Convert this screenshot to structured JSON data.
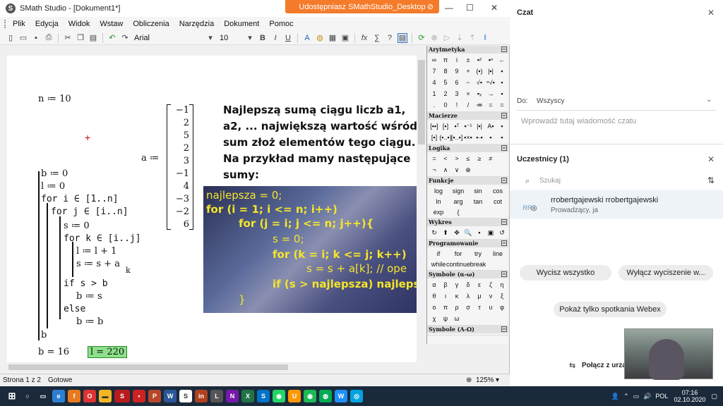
{
  "window": {
    "title": "SMath Studio - [Dokument1*]",
    "share_banner": "Udostępniasz SMathStudio_Desktop"
  },
  "menu": [
    "Plik",
    "Edycja",
    "Widok",
    "Wstaw",
    "Obliczenia",
    "Narzędzia",
    "Dokument",
    "Pomoc"
  ],
  "toolbar": {
    "font": "Arial",
    "size": "10"
  },
  "worksheet": {
    "n_def": "n ≔ 10",
    "a_label": "a ≔",
    "vector": [
      "−1",
      "2",
      "5",
      "2",
      "3",
      "−1",
      "4",
      "−3",
      "−2",
      "6"
    ],
    "code": [
      "b ≔ 0",
      "l ≔ 0",
      "for  i ∈ [1..n]",
      "for  j ∈ [i..n]",
      "s ≔ 0",
      "for  k ∈ [i..j]",
      "l ≔ l + 1",
      "s ≔ s + a",
      "k",
      "if  s > b",
      "b ≔ s",
      "else",
      "b ≔ b",
      "b"
    ],
    "result_b": "b = 16",
    "result_l": "l = 220",
    "text": "Najlepszą sumą ciągu liczb a1, a2, ... największą wartość wśród sum złoż elementów tego ciągu. Na przykład mamy następujące sumy:",
    "image_code": [
      "najlepsza = 0;",
      "for (i = 1; i <= n; i++)",
      "for (j = i; j <= n; j++){",
      "s = 0;",
      "for (k = i; k <= j; k++)",
      "s = s + a[k]; // ope",
      "if (s > najlepsza) najlepsz",
      "}"
    ]
  },
  "palette": {
    "sections": [
      {
        "title": "Arytmetyka",
        "items": [
          "∞",
          "π",
          "i",
          "±",
          "▪²",
          "▪ⁿ",
          "←",
          "7",
          "8",
          "9",
          "+",
          "(▪)",
          "|▪|",
          "▪",
          "4",
          "5",
          "6",
          "−",
          "√▪",
          "ⁿ√▪",
          "▪",
          "1",
          "2",
          "3",
          "×",
          "▪ₓ",
          "→",
          "▪",
          ".",
          "0",
          "!",
          "/",
          "≔",
          "=",
          "="
        ]
      },
      {
        "title": "Macierze",
        "items": [
          "[▪▪]",
          "[▪]",
          "▪ᵀ",
          "▪⁻¹",
          "|▪|",
          "A▪",
          "▪",
          "[▪]",
          "(▪..▪)",
          "[▪..▪]",
          "▪×▪",
          "▪·▪",
          "▪",
          "▪"
        ]
      },
      {
        "title": "Logika",
        "items": [
          "=",
          "<",
          ">",
          "≤",
          "≥",
          "≠",
          "",
          "¬",
          "∧",
          "∨",
          "⊕",
          "",
          "",
          ""
        ]
      },
      {
        "title": "Funkcje",
        "items4": [
          "log",
          "sign",
          "sin",
          "cos",
          "ln",
          "arg",
          "tan",
          "cot",
          "exp",
          "{"
        ]
      },
      {
        "title": "Wykres",
        "items": [
          "↻",
          "⬆",
          "✥",
          "🔍",
          "▪",
          "▣",
          "↺"
        ]
      },
      {
        "title": "Programowanie",
        "items4": [
          "if",
          "for",
          "try",
          "line",
          "while",
          "continue",
          "break",
          ""
        ]
      },
      {
        "title": "Symbole (α-ω)",
        "items": [
          "α",
          "β",
          "γ",
          "δ",
          "ε",
          "ζ",
          "η",
          "θ",
          "ι",
          "κ",
          "λ",
          "μ",
          "ν",
          "ξ",
          "ο",
          "π",
          "ρ",
          "σ",
          "τ",
          "υ",
          "φ",
          "χ",
          "ψ",
          "ω"
        ]
      },
      {
        "title": "Symbole (A-Ω)",
        "items": []
      }
    ]
  },
  "statusbar": {
    "page": "Strona 1 z 2",
    "state": "Gotowe",
    "zoom": "125%"
  },
  "chat": {
    "title": "Czat",
    "to_label": "Do:",
    "to_value": "Wszyscy",
    "placeholder": "Wprowadź tutaj wiadomość czatu",
    "participants_title": "Uczestnicy (1)",
    "search_placeholder": "Szukaj",
    "participant_name": "rrobertgajewski rrobertgajewski",
    "participant_role": "Prowadzący, ja",
    "avatar": "RR",
    "mute_all": "Wycisz wszystko",
    "unmute_all": "Wyłącz wyciszenie w...",
    "webex_only": "Pokaż tylko spotkania Webex",
    "connect": "Połącz z urzą"
  },
  "taskbar": {
    "lang": "POL",
    "time": "07:16",
    "date": "02.10.2020"
  }
}
